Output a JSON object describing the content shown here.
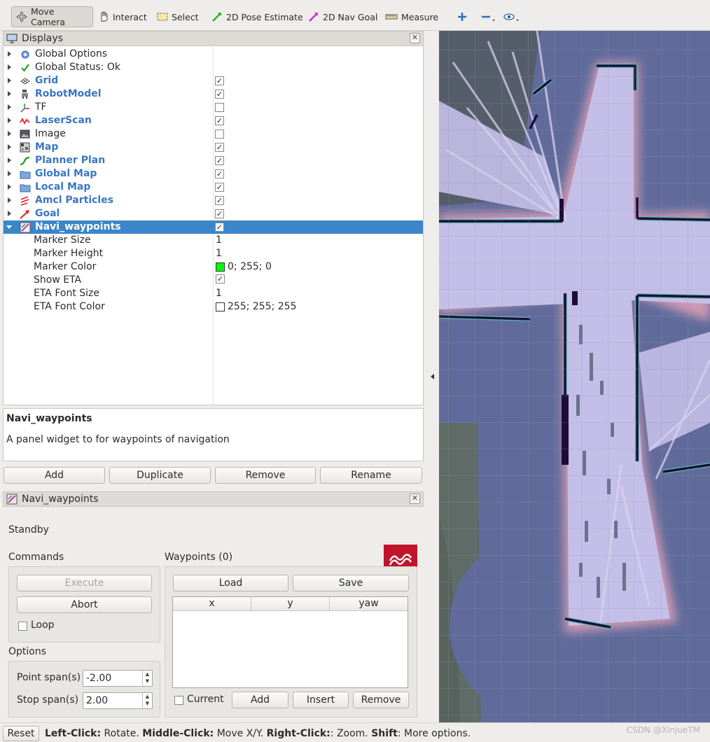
{
  "toolbar": {
    "tools": [
      "Move Camera",
      "Interact",
      "Select",
      "2D Pose Estimate",
      "2D Nav Goal",
      "Measure"
    ]
  },
  "displays": {
    "title": "Displays",
    "items": [
      {
        "name": "Global Options",
        "checked": null,
        "icon": "gear-icon"
      },
      {
        "name": "Global Status: Ok",
        "checked": null,
        "icon": "checkmark-icon"
      },
      {
        "name": "Grid",
        "checked": true,
        "icon": "grid-icon"
      },
      {
        "name": "RobotModel",
        "checked": true,
        "icon": "robot-icon"
      },
      {
        "name": "TF",
        "checked": false,
        "icon": "axes-icon"
      },
      {
        "name": "LaserScan",
        "checked": true,
        "icon": "laser-icon"
      },
      {
        "name": "Image",
        "checked": false,
        "icon": "image-icon"
      },
      {
        "name": "Map",
        "checked": true,
        "icon": "map-icon"
      },
      {
        "name": "Planner Plan",
        "checked": true,
        "icon": "path-icon"
      },
      {
        "name": "Global Map",
        "checked": true,
        "icon": "folder-icon"
      },
      {
        "name": "Local Map",
        "checked": true,
        "icon": "folder-icon"
      },
      {
        "name": "Amcl Particles",
        "checked": true,
        "icon": "pose-array-icon"
      },
      {
        "name": "Goal",
        "checked": true,
        "icon": "arrow-icon"
      },
      {
        "name": "Navi_waypoints",
        "checked": true,
        "icon": "waypoints-icon"
      }
    ],
    "properties": [
      {
        "name": "Marker Size",
        "value": "1"
      },
      {
        "name": "Marker Height",
        "value": "1"
      },
      {
        "name": "Marker Color",
        "value": "0; 255; 0",
        "swatch": "#00ff00"
      },
      {
        "name": "Show ETA",
        "value": "✓"
      },
      {
        "name": "ETA Font Size",
        "value": "1"
      },
      {
        "name": "ETA Font Color",
        "value": "255; 255; 255",
        "swatch": "#ffffff"
      }
    ],
    "description_title": "Navi_waypoints",
    "description_text": "A panel widget to for waypoints of navigation",
    "buttons": [
      "Add",
      "Duplicate",
      "Remove",
      "Rename"
    ]
  },
  "navi_panel": {
    "title": "Navi_waypoints",
    "state": "Standby",
    "commands_label": "Commands",
    "execute_label": "Execute",
    "abort_label": "Abort",
    "loop_label": "Loop",
    "options_label": "Options",
    "point_span_label": "Point span(s)",
    "point_span_value": "-2.00",
    "stop_span_label": "Stop span(s)",
    "stop_span_value": "2.00",
    "waypoints_label": "Waypoints (0)",
    "load_label": "Load",
    "save_label": "Save",
    "columns": [
      "x",
      "y",
      "yaw"
    ],
    "current_label": "Current",
    "add_label": "Add",
    "insert_label": "Insert",
    "remove_label": "Remove"
  },
  "status": {
    "reset_label": "Reset",
    "hint_parts": [
      {
        "bold": true,
        "text": "Left-Click:"
      },
      {
        "bold": false,
        "text": " Rotate. "
      },
      {
        "bold": true,
        "text": "Middle-Click:"
      },
      {
        "bold": false,
        "text": " Move X/Y. "
      },
      {
        "bold": true,
        "text": "Right-Click:"
      },
      {
        "bold": false,
        "text": ": Zoom. "
      },
      {
        "bold": true,
        "text": "Shift"
      },
      {
        "bold": false,
        "text": ": More options."
      }
    ],
    "watermark": "CSDN @XinjueTM"
  },
  "colors": {
    "selection": "#3a86c8",
    "link": "#3a76c2",
    "map_unknown": "#555d6b",
    "map_free": "#c2bce6",
    "map_inflation": "#e0a0b0",
    "map_wall": "#1c0d38",
    "map_edge": "#5fbab1"
  }
}
